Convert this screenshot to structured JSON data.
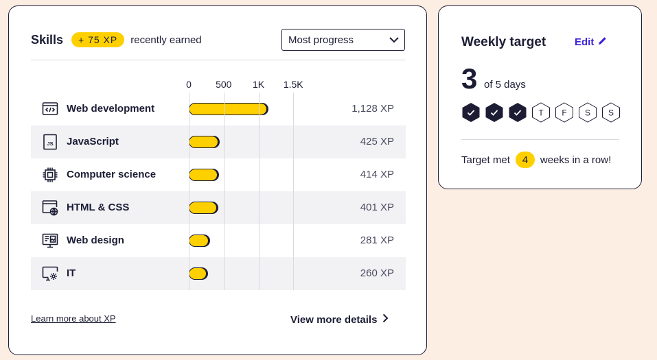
{
  "skills": {
    "title": "Skills",
    "xp_pill": "+ 75 XP",
    "recent_label": "recently earned",
    "sort_selected": "Most progress",
    "axis_ticks": [
      "0",
      "500",
      "1K",
      "1.5K"
    ],
    "rows": [
      {
        "label": "Web development",
        "xp": "1,128 XP",
        "value": 1128,
        "icon": "code-window-icon"
      },
      {
        "label": "JavaScript",
        "xp": "425 XP",
        "value": 425,
        "icon": "js-file-icon"
      },
      {
        "label": "Computer science",
        "xp": "414 XP",
        "value": 414,
        "icon": "cpu-chip-icon"
      },
      {
        "label": "HTML & CSS",
        "xp": "401 XP",
        "value": 401,
        "icon": "browser-globe-icon"
      },
      {
        "label": "Web design",
        "xp": "281 XP",
        "value": 281,
        "icon": "design-monitor-icon"
      },
      {
        "label": "IT",
        "xp": "260 XP",
        "value": 260,
        "icon": "gear-monitor-icon"
      }
    ],
    "learn_more": "Learn more about XP",
    "view_more": "View more details"
  },
  "weekly": {
    "title": "Weekly target",
    "edit_label": "Edit",
    "done_count": "3",
    "of_days": "of 5 days",
    "days": [
      {
        "letter": "",
        "done": true
      },
      {
        "letter": "",
        "done": true
      },
      {
        "letter": "",
        "done": true
      },
      {
        "letter": "T",
        "done": false
      },
      {
        "letter": "F",
        "done": false
      },
      {
        "letter": "S",
        "done": false
      },
      {
        "letter": "S",
        "done": false
      }
    ],
    "target_met_prefix": "Target met",
    "streak": "4",
    "target_met_suffix": "weeks in a row!"
  },
  "colors": {
    "accent": "#ffd000",
    "ink": "#1c1d35",
    "link": "#3b22d6",
    "background": "#fdeee4"
  }
}
